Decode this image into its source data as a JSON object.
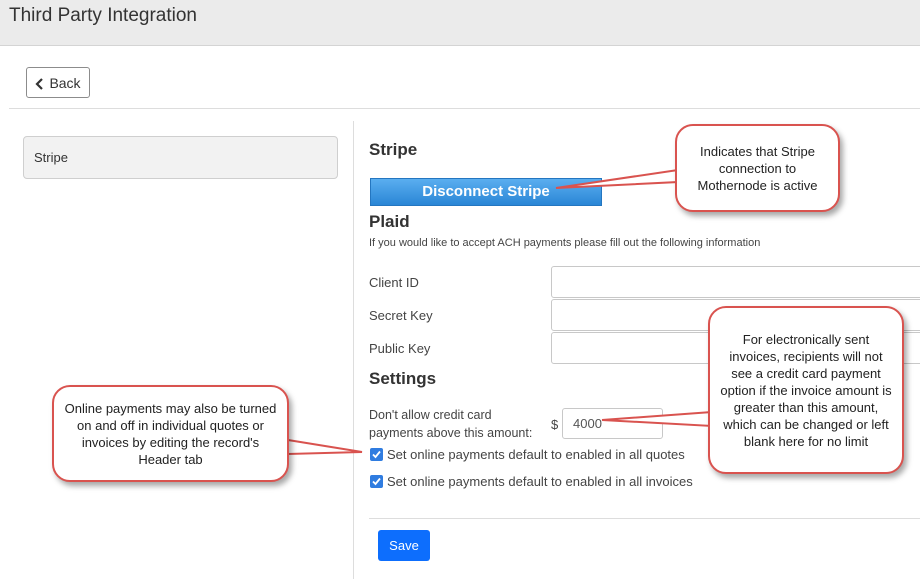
{
  "header": {
    "title": "Third Party Integration"
  },
  "toolbar": {
    "back_label": "Back",
    "back_icon": "chevron-left-icon"
  },
  "sidebar": {
    "items": [
      {
        "label": "Stripe"
      }
    ]
  },
  "stripe": {
    "heading": "Stripe",
    "disconnect_label": "Disconnect Stripe"
  },
  "plaid": {
    "heading": "Plaid",
    "description": "If you would like to accept ACH payments please fill out the following information",
    "fields": [
      {
        "label": "Client ID",
        "value": ""
      },
      {
        "label": "Secret Key",
        "value": ""
      },
      {
        "label": "Public Key",
        "value": ""
      }
    ]
  },
  "settings": {
    "heading": "Settings",
    "cc_limit_label": "Don't allow credit card payments above this amount:",
    "currency_symbol": "$",
    "cc_limit_value": "4000",
    "checkboxes": [
      {
        "label": "Set online payments default to enabled in all quotes",
        "checked": true
      },
      {
        "label": "Set online payments default to enabled in all invoices",
        "checked": true
      }
    ]
  },
  "footer": {
    "save_label": "Save"
  },
  "callouts": {
    "stripe_active": "Indicates that Stripe connection to Mothernode is active",
    "cc_limit": "For electronically sent invoices, recipients will not see a credit card payment option if the invoice amount is greater than this amount, which can be changed or left blank here for no limit",
    "online_payments": "Online payments may also be turned on and off in individual quotes or invoices by editing the record's Header tab"
  },
  "colors": {
    "accent": "#2a86d6",
    "primary": "#0d6efd",
    "callout_border": "#d9534f",
    "topbar": "#ebebeb"
  }
}
